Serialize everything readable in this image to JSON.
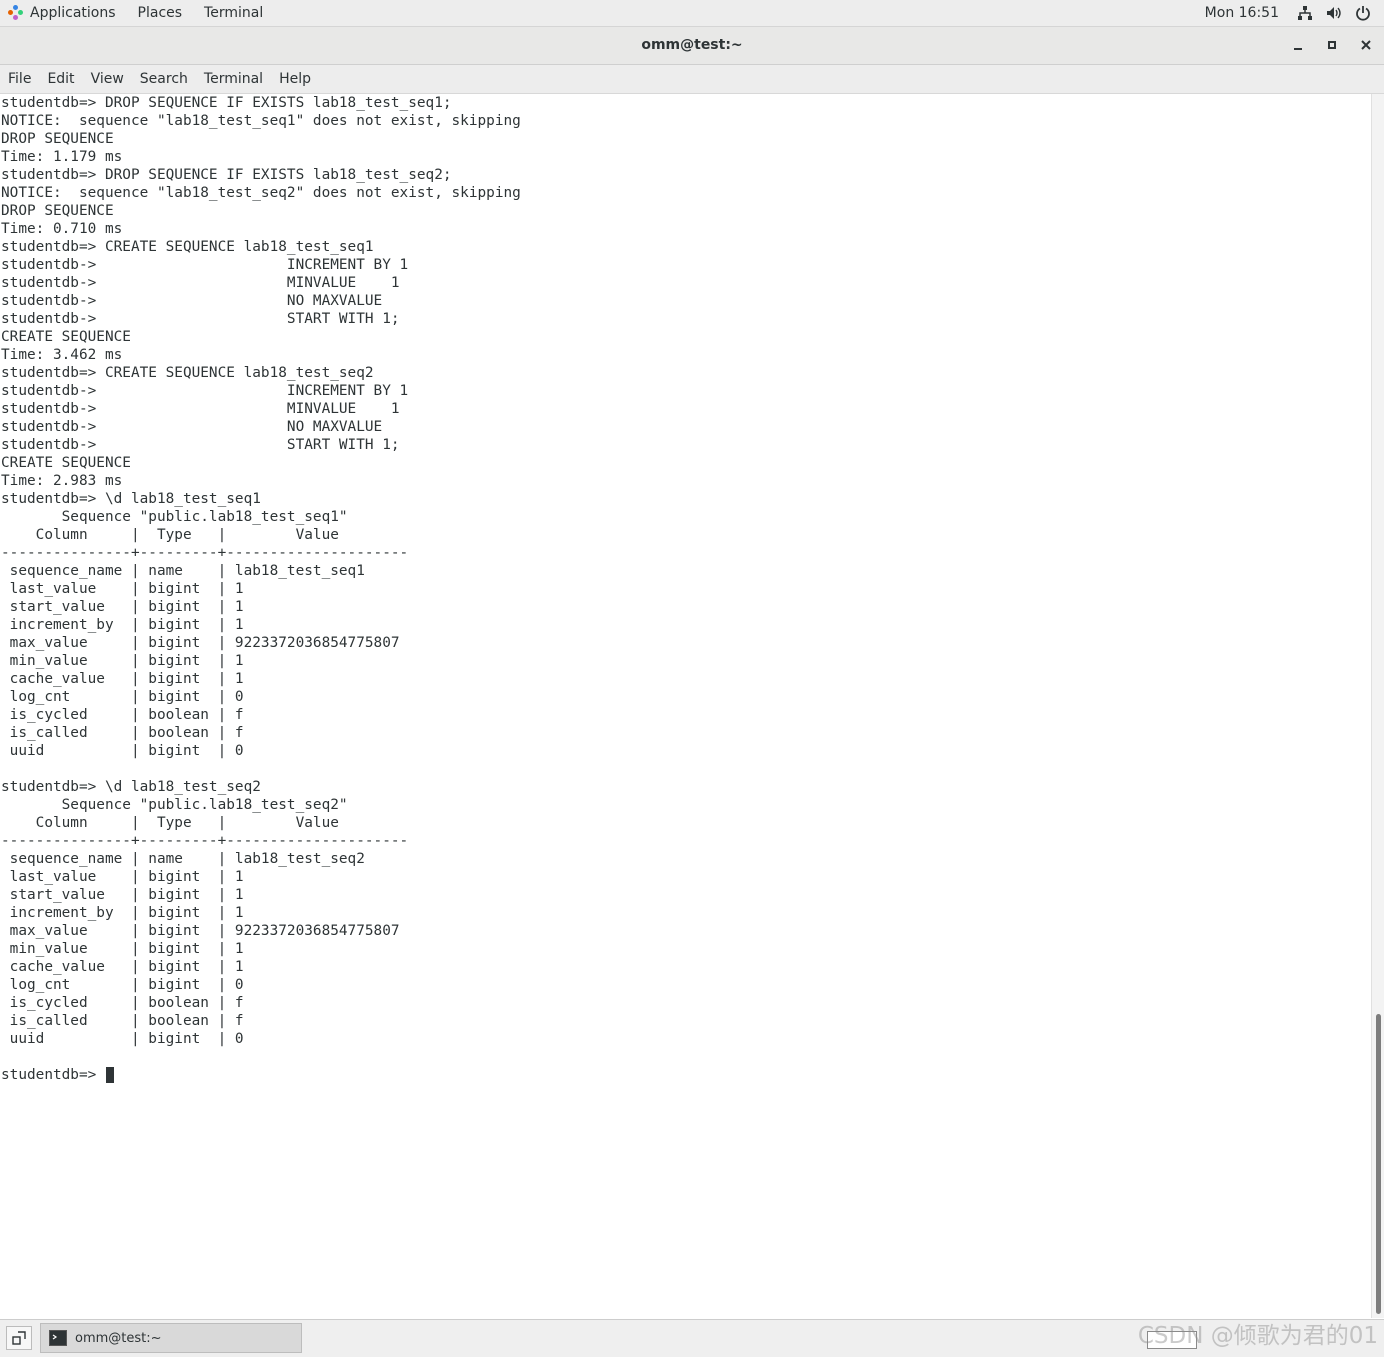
{
  "top_panel": {
    "applications": "Applications",
    "places": "Places",
    "terminal": "Terminal",
    "clock": "Mon 16:51",
    "icons": [
      "network-icon",
      "volume-icon",
      "power-icon"
    ]
  },
  "window": {
    "title": "omm@test:~",
    "controls": [
      "minimize-icon",
      "maximize-icon",
      "close-icon"
    ]
  },
  "menu": [
    "File",
    "Edit",
    "View",
    "Search",
    "Terminal",
    "Help"
  ],
  "terminal": {
    "lines": [
      "studentdb=> DROP SEQUENCE IF EXISTS lab18_test_seq1;",
      "NOTICE:  sequence \"lab18_test_seq1\" does not exist, skipping",
      "DROP SEQUENCE",
      "Time: 1.179 ms",
      "studentdb=> DROP SEQUENCE IF EXISTS lab18_test_seq2;",
      "NOTICE:  sequence \"lab18_test_seq2\" does not exist, skipping",
      "DROP SEQUENCE",
      "Time: 0.710 ms",
      "studentdb=> CREATE SEQUENCE lab18_test_seq1",
      "studentdb->                      INCREMENT BY 1",
      "studentdb->                      MINVALUE    1",
      "studentdb->                      NO MAXVALUE",
      "studentdb->                      START WITH 1;",
      "CREATE SEQUENCE",
      "Time: 3.462 ms",
      "studentdb=> CREATE SEQUENCE lab18_test_seq2",
      "studentdb->                      INCREMENT BY 1",
      "studentdb->                      MINVALUE    1",
      "studentdb->                      NO MAXVALUE",
      "studentdb->                      START WITH 1;",
      "CREATE SEQUENCE",
      "Time: 2.983 ms",
      "studentdb=> \\d lab18_test_seq1",
      "       Sequence \"public.lab18_test_seq1\"",
      "    Column     |  Type   |        Value",
      "---------------+---------+---------------------",
      " sequence_name | name    | lab18_test_seq1",
      " last_value    | bigint  | 1",
      " start_value   | bigint  | 1",
      " increment_by  | bigint  | 1",
      " max_value     | bigint  | 9223372036854775807",
      " min_value     | bigint  | 1",
      " cache_value   | bigint  | 1",
      " log_cnt       | bigint  | 0",
      " is_cycled     | boolean | f",
      " is_called     | boolean | f",
      " uuid          | bigint  | 0",
      "",
      "studentdb=> \\d lab18_test_seq2",
      "       Sequence \"public.lab18_test_seq2\"",
      "    Column     |  Type   |        Value",
      "---------------+---------+---------------------",
      " sequence_name | name    | lab18_test_seq2",
      " last_value    | bigint  | 1",
      " start_value   | bigint  | 1",
      " increment_by  | bigint  | 1",
      " max_value     | bigint  | 9223372036854775807",
      " min_value     | bigint  | 1",
      " cache_value   | bigint  | 1",
      " log_cnt       | bigint  | 0",
      " is_cycled     | boolean | f",
      " is_called     | boolean | f",
      " uuid          | bigint  | 0",
      "",
      "studentdb=> "
    ]
  },
  "taskbar": {
    "task_label": "omm@test:~",
    "watermark": "CSDN @倾歌为君的01"
  },
  "colors": {
    "terminal_text": "#2e3436",
    "terminal_bg": "#ffffff",
    "panel_bg": "#ededed"
  }
}
